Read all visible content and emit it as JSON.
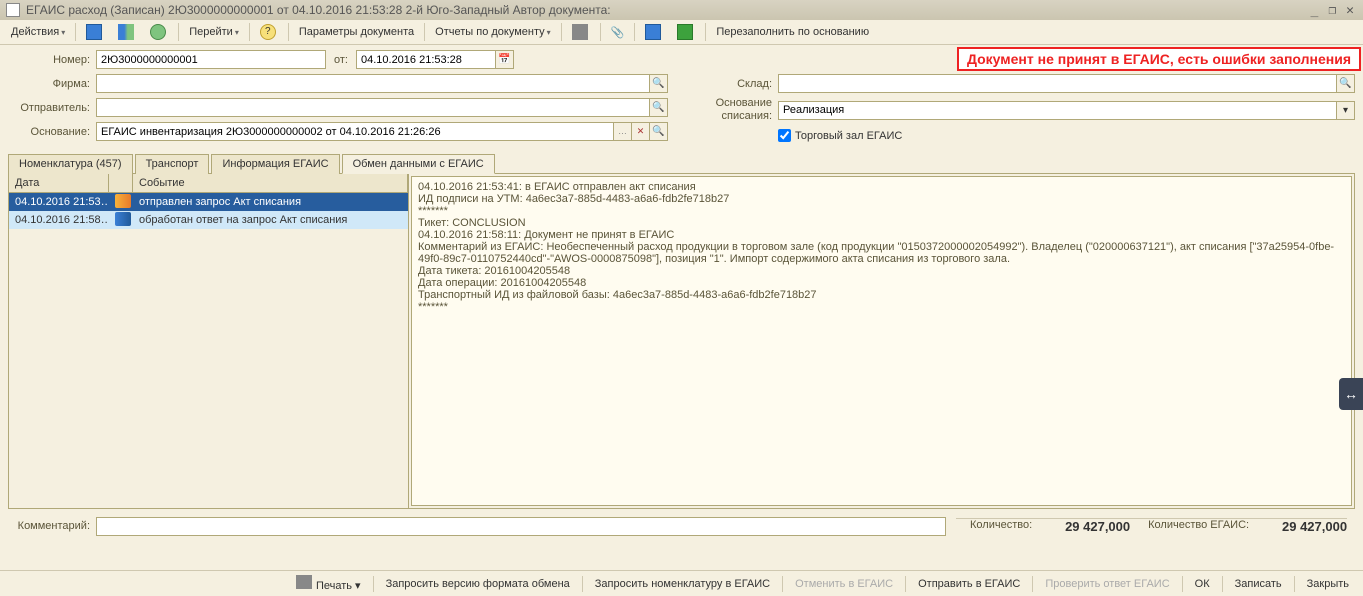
{
  "window": {
    "title": "ЕГАИС расход (Записан)   2Ю3000000000001 от 04.10.2016 21:53:28 2-й Юго-Западный Автор документа:"
  },
  "toolbar": {
    "actions": "Действия",
    "goto": "Перейти",
    "doc_params": "Параметры документа",
    "reports": "Отчеты по документу",
    "refill": "Перезаполнить по основанию"
  },
  "error_banner": "Документ не принят в ЕГАИС, есть ошибки заполнения",
  "fields": {
    "number_label": "Номер:",
    "number": "2Ю3000000000001",
    "ot_label": "от:",
    "date": "04.10.2016 21:53:28",
    "firm_label": "Фирма:",
    "firm": "",
    "sender_label": "Отправитель:",
    "sender": "",
    "basis_label": "Основание:",
    "basis": "ЕГАИС инвентаризация 2Ю3000000000002 от 04.10.2016 21:26:26",
    "warehouse_label": "Склад:",
    "warehouse": "",
    "writeoff_label": "Основание списания:",
    "writeoff": "Реализация",
    "trade_hall_label": "Торговый зал ЕГАИС",
    "trade_hall_checked": true
  },
  "tabs": [
    {
      "label": "Номенклатура (457)",
      "active": false
    },
    {
      "label": "Транспорт",
      "active": false
    },
    {
      "label": "Информация ЕГАИС",
      "active": false
    },
    {
      "label": "Обмен данными с ЕГАИС",
      "active": true
    }
  ],
  "event_table": {
    "col_date": "Дата",
    "col_event": "Событие",
    "rows": [
      {
        "date": "04.10.2016 21:53…",
        "event": "отправлен запрос Акт списания",
        "dir": "out",
        "selected": true
      },
      {
        "date": "04.10.2016 21:58…",
        "event": "обработан ответ на запрос Акт списания",
        "dir": "in",
        "selected": false
      }
    ]
  },
  "detail_text": "04.10.2016 21:53:41: в ЕГАИС отправлен акт списания\nИД подписи на УТМ: 4a6ec3a7-885d-4483-a6a6-fdb2fe718b27\n*******\nТикет: CONCLUSION\n04.10.2016 21:58:11: Документ не принят в ЕГАИС\nКомментарий из ЕГАИС: Необеспеченный расход продукции в торговом зале (код продукции \"0150372000002054992\"). Владелец (\"020000637121\"), акт списания [\"37a25954-0fbe-49f0-89c7-0110752440cd\"-\"AWOS-0000875098\"], позиция \"1\". Импорт содержимого акта списания из торгового зала.\nДата тикета: 20161004205548\nДата операции: 20161004205548\nТранспортный ИД из файловой базы: 4a6ec3a7-885d-4483-a6a6-fdb2fe718b27\n*******",
  "footer": {
    "comment_label": "Комментарий:",
    "qty_label": "Количество:",
    "qty_val": "29 427,000",
    "qty_egais_label": "Количество ЕГАИС:",
    "qty_egais_val": "29 427,000"
  },
  "bottom": {
    "print": "Печать",
    "request_format": "Запросить версию формата обмена",
    "request_nom": "Запросить номенклатуру в ЕГАИС",
    "cancel_egais": "Отменить в ЕГАИС",
    "send_egais": "Отправить в ЕГАИС",
    "check_reply": "Проверить ответ ЕГАИС",
    "ok": "ОК",
    "save": "Записать",
    "close": "Закрыть"
  }
}
